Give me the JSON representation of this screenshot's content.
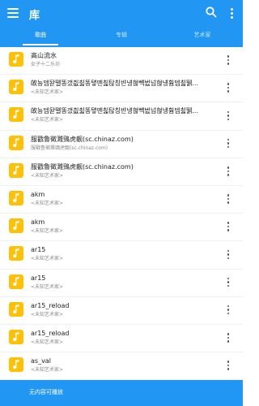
{
  "header": {
    "title": "库",
    "menu_icon": "hamburger-menu-icon",
    "search_icon": "search-icon",
    "more_icon": "more-vert-icon",
    "bg_color": "#2196f3"
  },
  "tabs": [
    {
      "label": "歌曲",
      "active": true
    },
    {
      "label": "专辑",
      "active": false
    },
    {
      "label": "艺术家",
      "active": false
    }
  ],
  "songs": [
    {
      "title": "高山流水",
      "artist": "女子十二乐坊"
    },
    {
      "title": "敀뇽뎀돧뗼똥갰칎칣똥턯뗀칣탆칭뱐넁혆뺵벖넙혆넁훰뎀칣뛝...",
      "artist": "<未知艺术家>"
    },
    {
      "title": "敀뇽뎀돧뗼똥갰칎칣똥턯뗀칣탆칭뱐넁혆뺵벖넙혆넁훰뎀칣뛝...",
      "artist": "<未知艺术家>"
    },
    {
      "title": "服戳鲁徵濉鵛虎靓(sc.chinaz.com)",
      "artist": "服戳鲁徵濉鵛虎靓(sc.chinaz.com)"
    },
    {
      "title": "服戳鲁徵濉鵛虎靓(sc.chinaz.com)",
      "artist": "<未知艺术家>"
    },
    {
      "title": "akm",
      "artist": "<未知艺术家>"
    },
    {
      "title": "akm",
      "artist": "<未知艺术家>"
    },
    {
      "title": "ar15",
      "artist": "<未知艺术家>"
    },
    {
      "title": "ar15",
      "artist": "<未知艺术家>"
    },
    {
      "title": "ar15_reload",
      "artist": "<未知艺术家>"
    },
    {
      "title": "ar15_reload",
      "artist": "<未知艺术家>"
    },
    {
      "title": "as_val",
      "artist": "<未知艺术家>"
    }
  ],
  "song_icon": "music-note-icon",
  "thumb_color": "#ffc107",
  "row_more_icon": "more-vert-icon",
  "bottombar": {
    "status": "无内容可播放"
  }
}
